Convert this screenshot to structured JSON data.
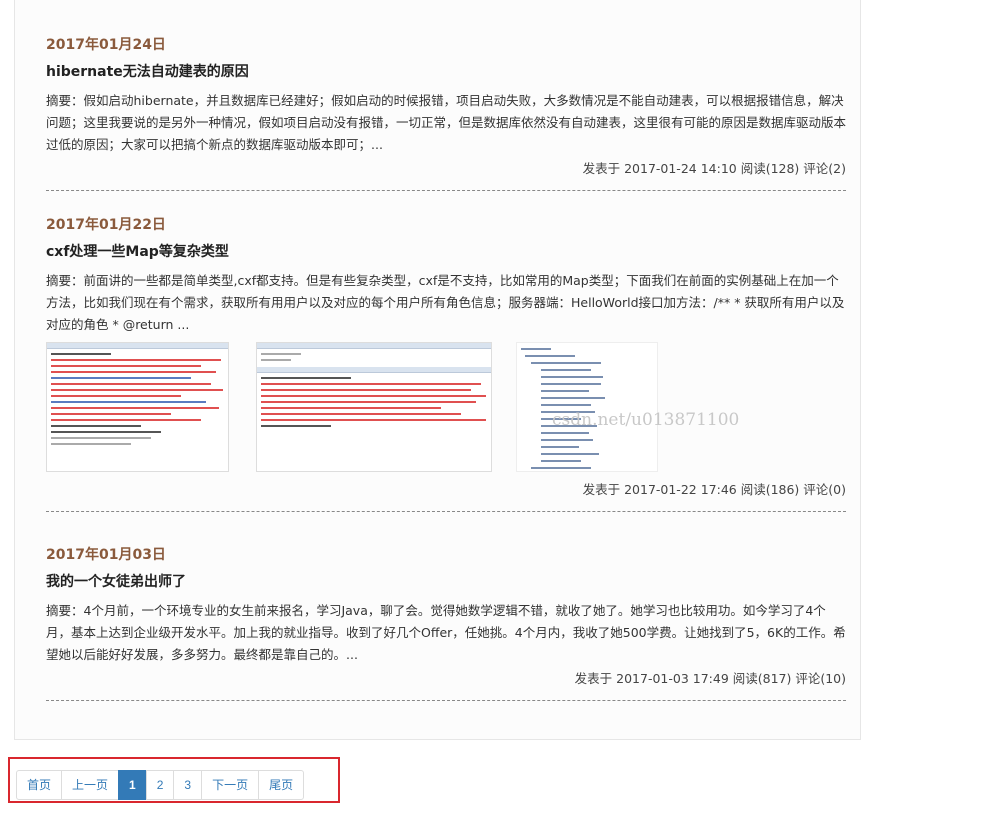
{
  "posts": [
    {
      "date": "2017年01月24日",
      "title": "hibernate无法自动建表的原因",
      "summary": "摘要：假如启动hibernate，并且数据库已经建好；假如启动的时候报错，项目启动失败，大多数情况是不能自动建表，可以根据报错信息，解决问题；这里我要说的是另外一种情况，假如项目启动没有报错，一切正常，但是数据库依然没有自动建表，这里很有可能的原因是数据库驱动版本过低的原因；大家可以把搞个新点的数据库驱动版本即可；...",
      "meta": "发表于 2017-01-24 14:10 阅读(128) 评论(2)"
    },
    {
      "date": "2017年01月22日",
      "title": "cxf处理一些Map等复杂类型",
      "summary": "摘要：前面讲的一些都是简单类型,cxf都支持。但是有些复杂类型，cxf是不支持，比如常用的Map类型；下面我们在前面的实例基础上在加一个方法，比如我们现在有个需求，获取所有用用户以及对应的每个用户所有角色信息；服务器端：HelloWorld接口加方法：/** * 获取所有用户以及对应的角色 * @return ...",
      "meta": "发表于 2017-01-22 17:46 阅读(186) 评论(0)",
      "watermark": "csdn.net/u013871100"
    },
    {
      "date": "2017年01月03日",
      "title": "我的一个女徒弟出师了",
      "summary": "摘要：4个月前，一个环境专业的女生前来报名，学习Java，聊了会。觉得她数学逻辑不错，就收了她了。她学习也比较用功。如今学习了4个月，基本上达到企业级开发水平。加上我的就业指导。收到了好几个Offer，任她挑。4个月内，我收了她500学费。让她找到了5，6K的工作。希望她以后能好好发展，多多努力。最终都是靠自己的。...",
      "meta": "发表于 2017-01-03 17:49 阅读(817) 评论(10)"
    }
  ],
  "pager": {
    "first": "首页",
    "prev": "上一页",
    "pages": [
      "1",
      "2",
      "3"
    ],
    "next": "下一页",
    "last": "尾页"
  },
  "colors": {
    "date": "#8a5a3c",
    "pager_active": "#337ab7",
    "highlight_box": "#d9272e"
  }
}
